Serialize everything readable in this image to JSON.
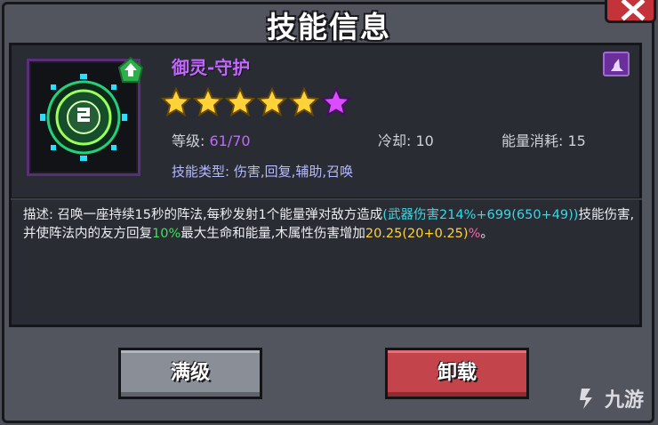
{
  "dialog": {
    "title": "技能信息"
  },
  "skill": {
    "name": "御灵-守护",
    "stars_filled": 5,
    "stars_total": 6,
    "level_label": "等级:",
    "level_value": "61/70",
    "cooldown_label": "冷却:",
    "cooldown_value": "10",
    "energy_label": "能量消耗:",
    "energy_value": "15",
    "type_label": "技能类型:",
    "type_value": "伤害,回复,辅助,召唤",
    "description": {
      "p1": "描述: 召唤一座持续15秒的阵法,每秒发射1个能量弹对敌方造成",
      "p2": "(武器伤害214%+699(650+49))",
      "p3": "技能伤害,并使阵法内的友方回复",
      "p4": "10%",
      "p5": "最大生命和能量,木属性伤害增加",
      "p6": "20.25(20+0.25)",
      "p7": "%",
      "p8": "。"
    }
  },
  "buttons": {
    "max_level": "满级",
    "uninstall": "卸载"
  },
  "watermark": {
    "text": "九游"
  },
  "colors": {
    "accent_purple": "#c267ff",
    "highlight_cyan": "#39d7e6",
    "highlight_green": "#3fe05a",
    "highlight_yellow": "#ffd23a",
    "danger_red": "#c4444c"
  }
}
